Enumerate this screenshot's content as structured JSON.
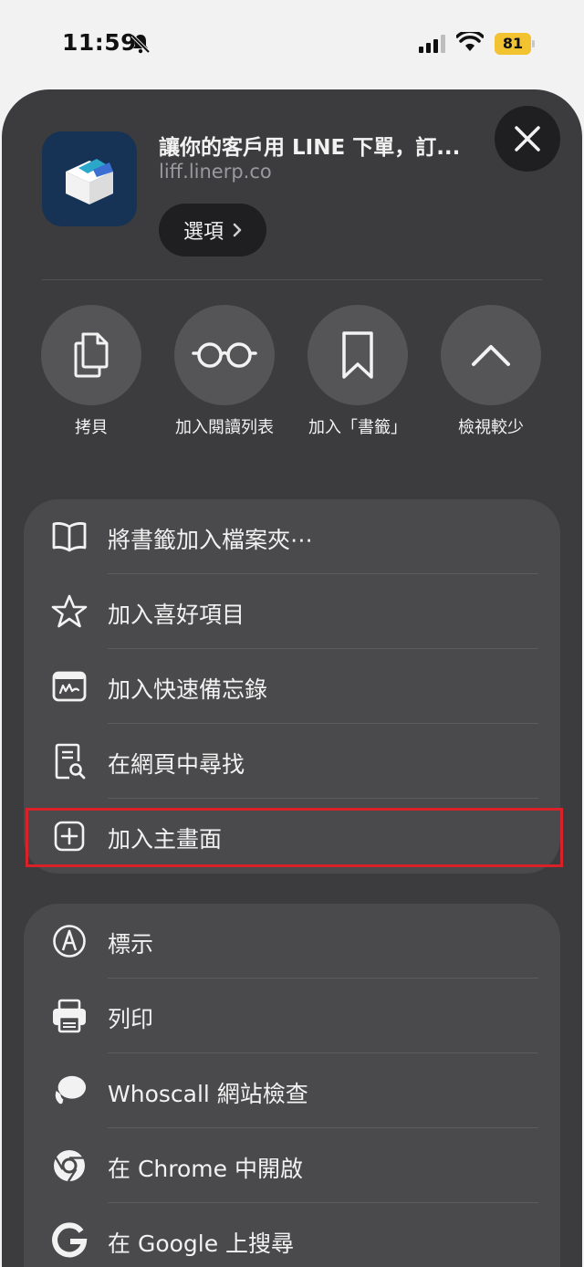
{
  "status_bar": {
    "time": "11:59",
    "battery": "81"
  },
  "header": {
    "title": "讓你的客戶用 LINE 下單，訂...",
    "url": "liff.linerp.co",
    "options_label": "選項"
  },
  "actions": [
    {
      "label": "拷貝",
      "icon": "copy-icon"
    },
    {
      "label": "加入閱讀列表",
      "icon": "reading-glasses-icon"
    },
    {
      "label": "加入「書籤」",
      "icon": "bookmark-icon"
    },
    {
      "label": "檢視較少",
      "icon": "chevron-up-icon"
    }
  ],
  "menu_group_1": [
    {
      "label": "將書籤加入檔案夾⋯",
      "icon": "book-icon"
    },
    {
      "label": "加入喜好項目",
      "icon": "star-icon"
    },
    {
      "label": "加入快速備忘錄",
      "icon": "quick-note-icon"
    },
    {
      "label": "在網頁中尋找",
      "icon": "find-in-page-icon"
    },
    {
      "label": "加入主畫面",
      "icon": "add-square-icon"
    }
  ],
  "menu_group_2": [
    {
      "label": "標示",
      "icon": "markup-pen-icon"
    },
    {
      "label": "列印",
      "icon": "printer-icon"
    },
    {
      "label": "Whoscall 網站檢查",
      "icon": "whoscall-bubble-icon"
    },
    {
      "label": "在 Chrome 中開啟",
      "icon": "chrome-icon"
    },
    {
      "label": "在 Google 上搜尋",
      "icon": "google-icon"
    }
  ],
  "colors": {
    "highlight_border": "#d9212a",
    "sheet_bg": "#3c3c3e",
    "group_bg": "#4a4a4c",
    "battery": "#f2c230"
  }
}
